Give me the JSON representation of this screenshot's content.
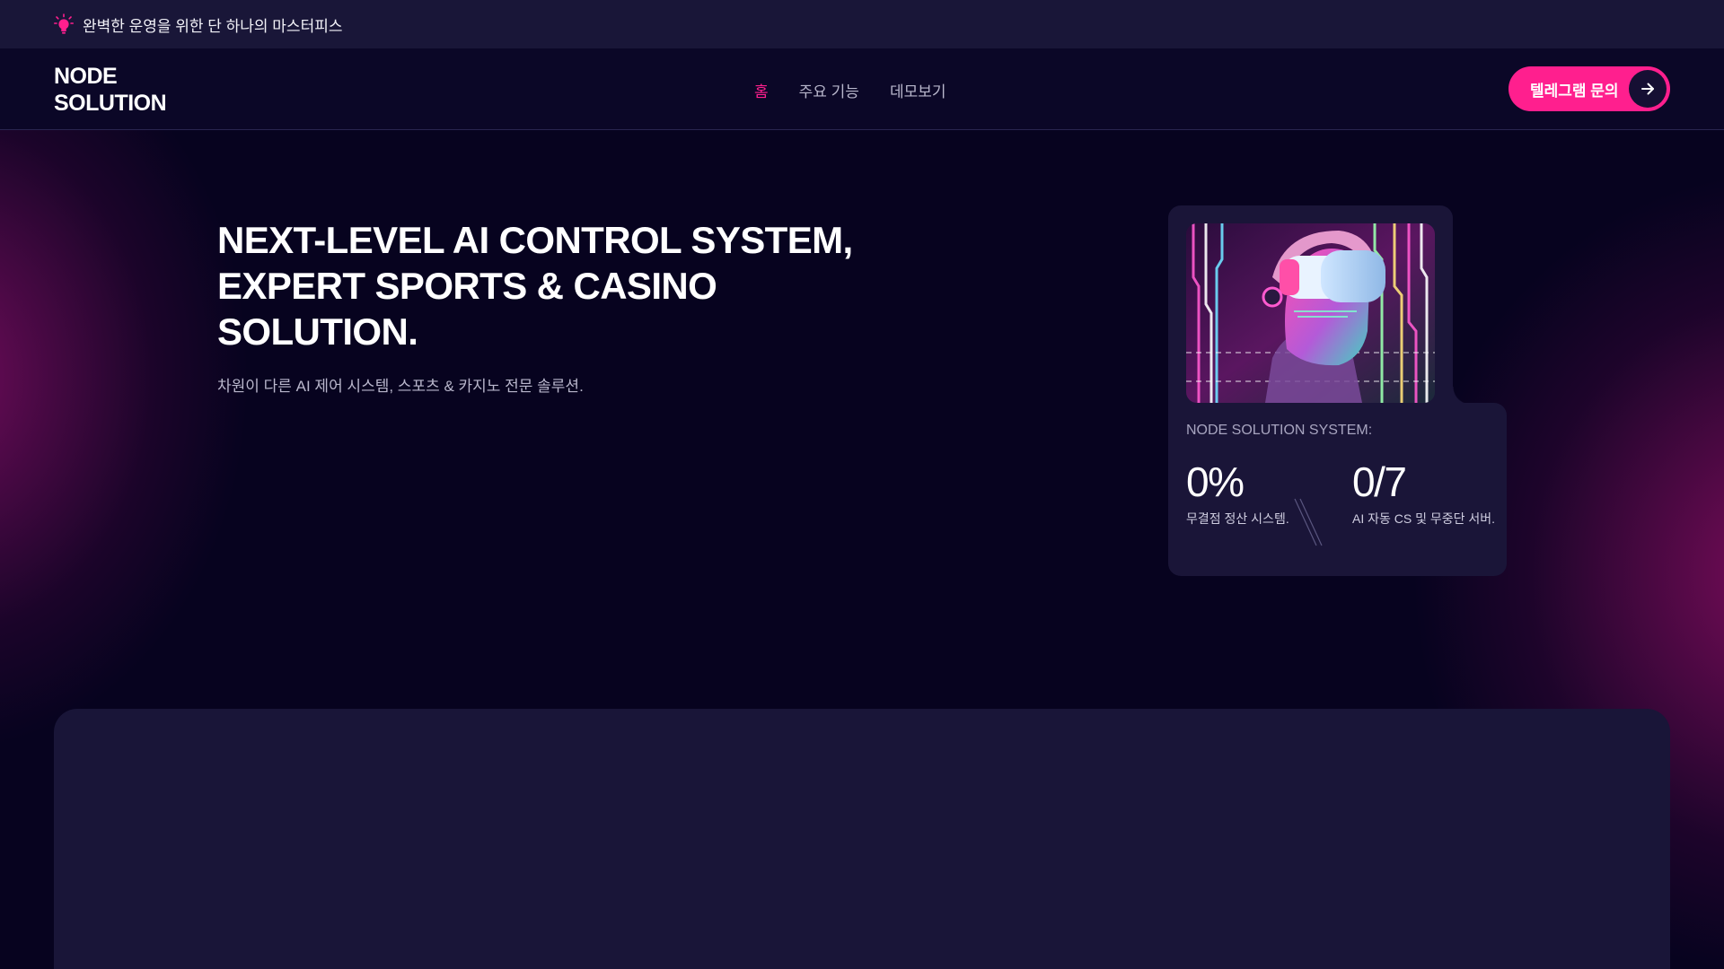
{
  "announcement": {
    "text": "완벽한 운영을 위한 단 하나의 마스터피스",
    "icon": "lightbulb-icon"
  },
  "header": {
    "logo_line1": "NODE",
    "logo_line2": "SOLUTION",
    "nav": [
      {
        "label": "홈",
        "active": true
      },
      {
        "label": "주요 기능",
        "active": false
      },
      {
        "label": "데모보기",
        "active": false
      }
    ],
    "cta_label": "텔레그램 문의",
    "cta_icon": "arrow-right-icon"
  },
  "hero": {
    "title_line1": "NEXT-LEVEL AI CONTROL SYSTEM,",
    "title_line2": "EXPERT SPORTS & CASINO",
    "title_line3": "SOLUTION.",
    "subtitle": "차원이 다른 AI 제어 시스템, 스포츠 & 카지노 전문 솔루션."
  },
  "stats_card": {
    "label": "NODE SOLUTION SYSTEM:",
    "stats": [
      {
        "value": "0%",
        "desc": "무결점 정산 시스템."
      },
      {
        "value": "0/7",
        "desc": "AI 자동 CS 및 무중단 서버."
      }
    ]
  },
  "colors": {
    "accent": "#ff1f8e",
    "background": "#07031f",
    "surface": "#1a1538",
    "announcement_bg": "#191638"
  }
}
